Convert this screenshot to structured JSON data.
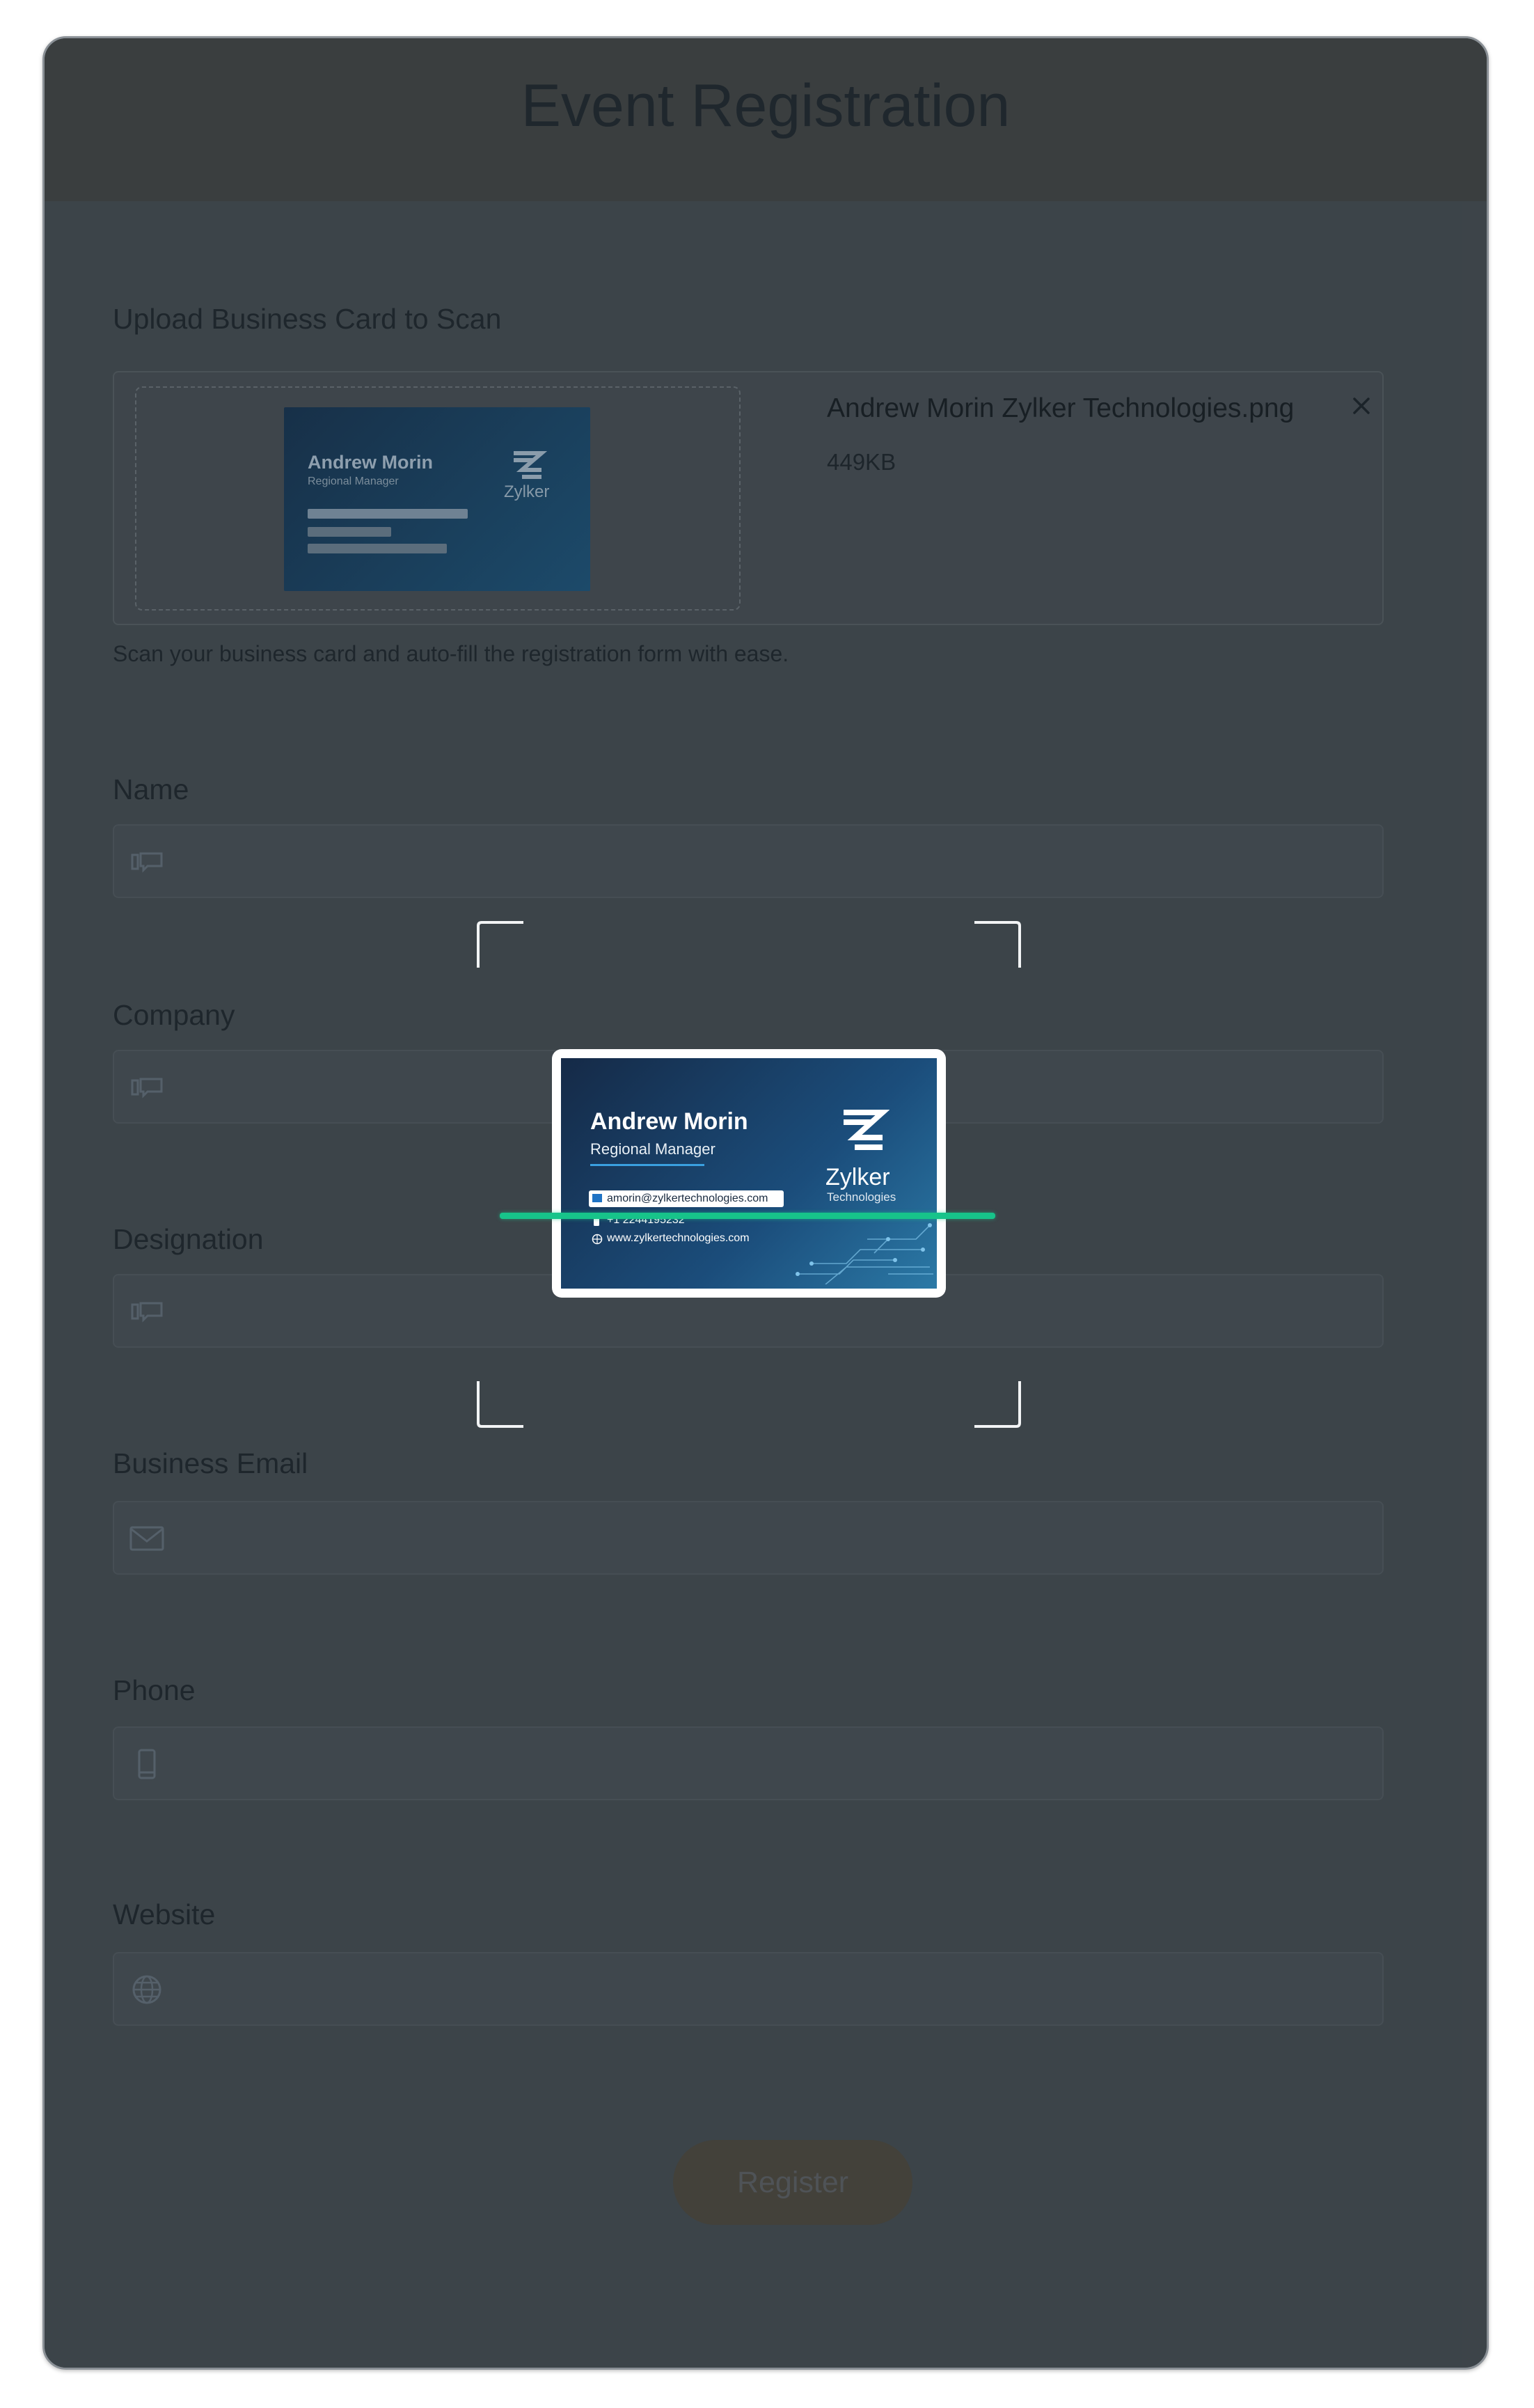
{
  "page": {
    "title": "Event Registration"
  },
  "upload": {
    "label": "Upload Business Card to Scan",
    "file_name": "Andrew Morin Zylker Technologies.png",
    "file_size": "449KB",
    "hint": "Scan your business card and auto-fill the registration form with ease."
  },
  "fields": {
    "name": {
      "label": "Name",
      "icon": "id-card-icon",
      "value": ""
    },
    "company": {
      "label": "Company",
      "icon": "id-card-icon",
      "value": ""
    },
    "designation": {
      "label": "Designation",
      "icon": "id-card-icon",
      "value": ""
    },
    "email": {
      "label": "Business Email",
      "icon": "envelope-icon",
      "value": ""
    },
    "phone": {
      "label": "Phone",
      "icon": "mobile-phone-icon",
      "value": ""
    },
    "website": {
      "label": "Website",
      "icon": "globe-icon",
      "value": ""
    }
  },
  "register": {
    "label": "Register"
  },
  "business_card": {
    "name": "Andrew Morin",
    "title": "Regional Manager",
    "email": "amorin@zylkertechnologies.com",
    "phone": "+1 2244195232",
    "website": "www.zylkertechnologies.com",
    "brand": "Zylker",
    "brand_sub": "Technologies"
  },
  "colors": {
    "scan_line": "#17c48a",
    "card_bg": "#1b4d7b"
  }
}
